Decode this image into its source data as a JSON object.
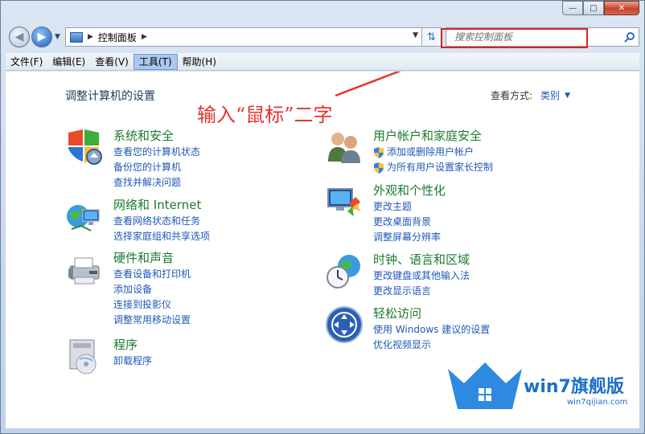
{
  "window": {
    "caption_buttons": {
      "minimize": "—",
      "maximize": "□",
      "close": "✕"
    }
  },
  "address": {
    "breadcrumb": "控制面板",
    "search_placeholder": "搜索控制面板"
  },
  "menu": [
    "文件(F)",
    "编辑(E)",
    "查看(V)",
    "工具(T)",
    "帮助(H)"
  ],
  "main": {
    "title": "调整计算机的设置",
    "view_by_label": "查看方式:",
    "view_by_value": "类别"
  },
  "annotation": "输入“鼠标”二字",
  "categories": {
    "system": {
      "title": "系统和安全",
      "links": [
        "查看您的计算机状态",
        "备份您的计算机",
        "查找并解决问题"
      ]
    },
    "network": {
      "title": "网络和 Internet",
      "links": [
        "查看网络状态和任务",
        "选择家庭组和共享选项"
      ]
    },
    "hardware": {
      "title": "硬件和声音",
      "links": [
        "查看设备和打印机",
        "添加设备",
        "连接到投影仪",
        "调整常用移动设置"
      ]
    },
    "programs": {
      "title": "程序",
      "links": [
        "卸载程序"
      ]
    },
    "users": {
      "title": "用户帐户和家庭安全",
      "links": [
        "添加或删除用户帐户",
        "为所有用户设置家长控制"
      ]
    },
    "appearance": {
      "title": "外观和个性化",
      "links": [
        "更改主题",
        "更改桌面背景",
        "调整屏幕分辨率"
      ]
    },
    "clock": {
      "title": "时钟、语言和区域",
      "links": [
        "更改键盘或其他输入法",
        "更改显示语言"
      ]
    },
    "ease": {
      "title": "轻松访问",
      "links": [
        "使用 Windows 建议的设置",
        "优化视频显示"
      ]
    }
  },
  "watermark": {
    "brand": "win7旗舰版",
    "site": "win7qijian.com"
  }
}
